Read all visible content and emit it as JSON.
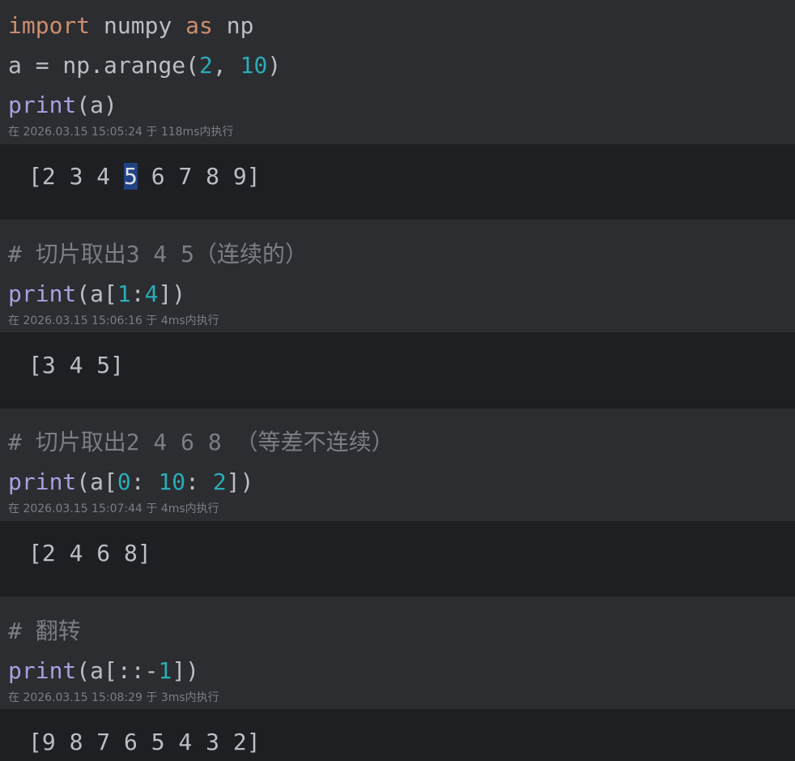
{
  "cells": [
    {
      "code": {
        "line1": {
          "kw1": "import",
          "text1": " numpy ",
          "kw2": "as",
          "text2": " np"
        },
        "line2": {
          "text1": "a = np.arange(",
          "num1": "2",
          "sep": ", ",
          "num2": "10",
          "text2": ")"
        },
        "line3": {
          "fn": "print",
          "text": "(a)"
        }
      },
      "meta": "在 2026.03.15 15:05:24 于 118ms内执行",
      "output": {
        "before": "[2 3 4 ",
        "selected": "5",
        "after": " 6 7 8 9]"
      }
    },
    {
      "code": {
        "comment": "# 切片取出3 4 5（连续的）",
        "line2": {
          "fn": "print",
          "t1": "(a[",
          "n1": "1",
          "t2": ":",
          "n2": "4",
          "t3": "])"
        }
      },
      "meta": "在 2026.03.15 15:06:16 于 4ms内执行",
      "output": "[3 4 5]"
    },
    {
      "code": {
        "comment": "# 切片取出2 4 6 8 （等差不连续）",
        "line2": {
          "fn": "print",
          "t1": "(a[",
          "n1": "0",
          "t2": ": ",
          "n2": "10",
          "t3": ": ",
          "n3": "2",
          "t4": "])"
        }
      },
      "meta": "在 2026.03.15 15:07:44 于 4ms内执行",
      "output": "[2 4 6 8]"
    },
    {
      "code": {
        "comment": "# 翻转",
        "line2": {
          "fn": "print",
          "t1": "(a[::-",
          "n1": "1",
          "t2": "])"
        }
      },
      "meta": "在 2026.03.15 15:08:29 于 3ms内执行",
      "output": "[9 8 7 6 5 4 3 2]"
    }
  ]
}
